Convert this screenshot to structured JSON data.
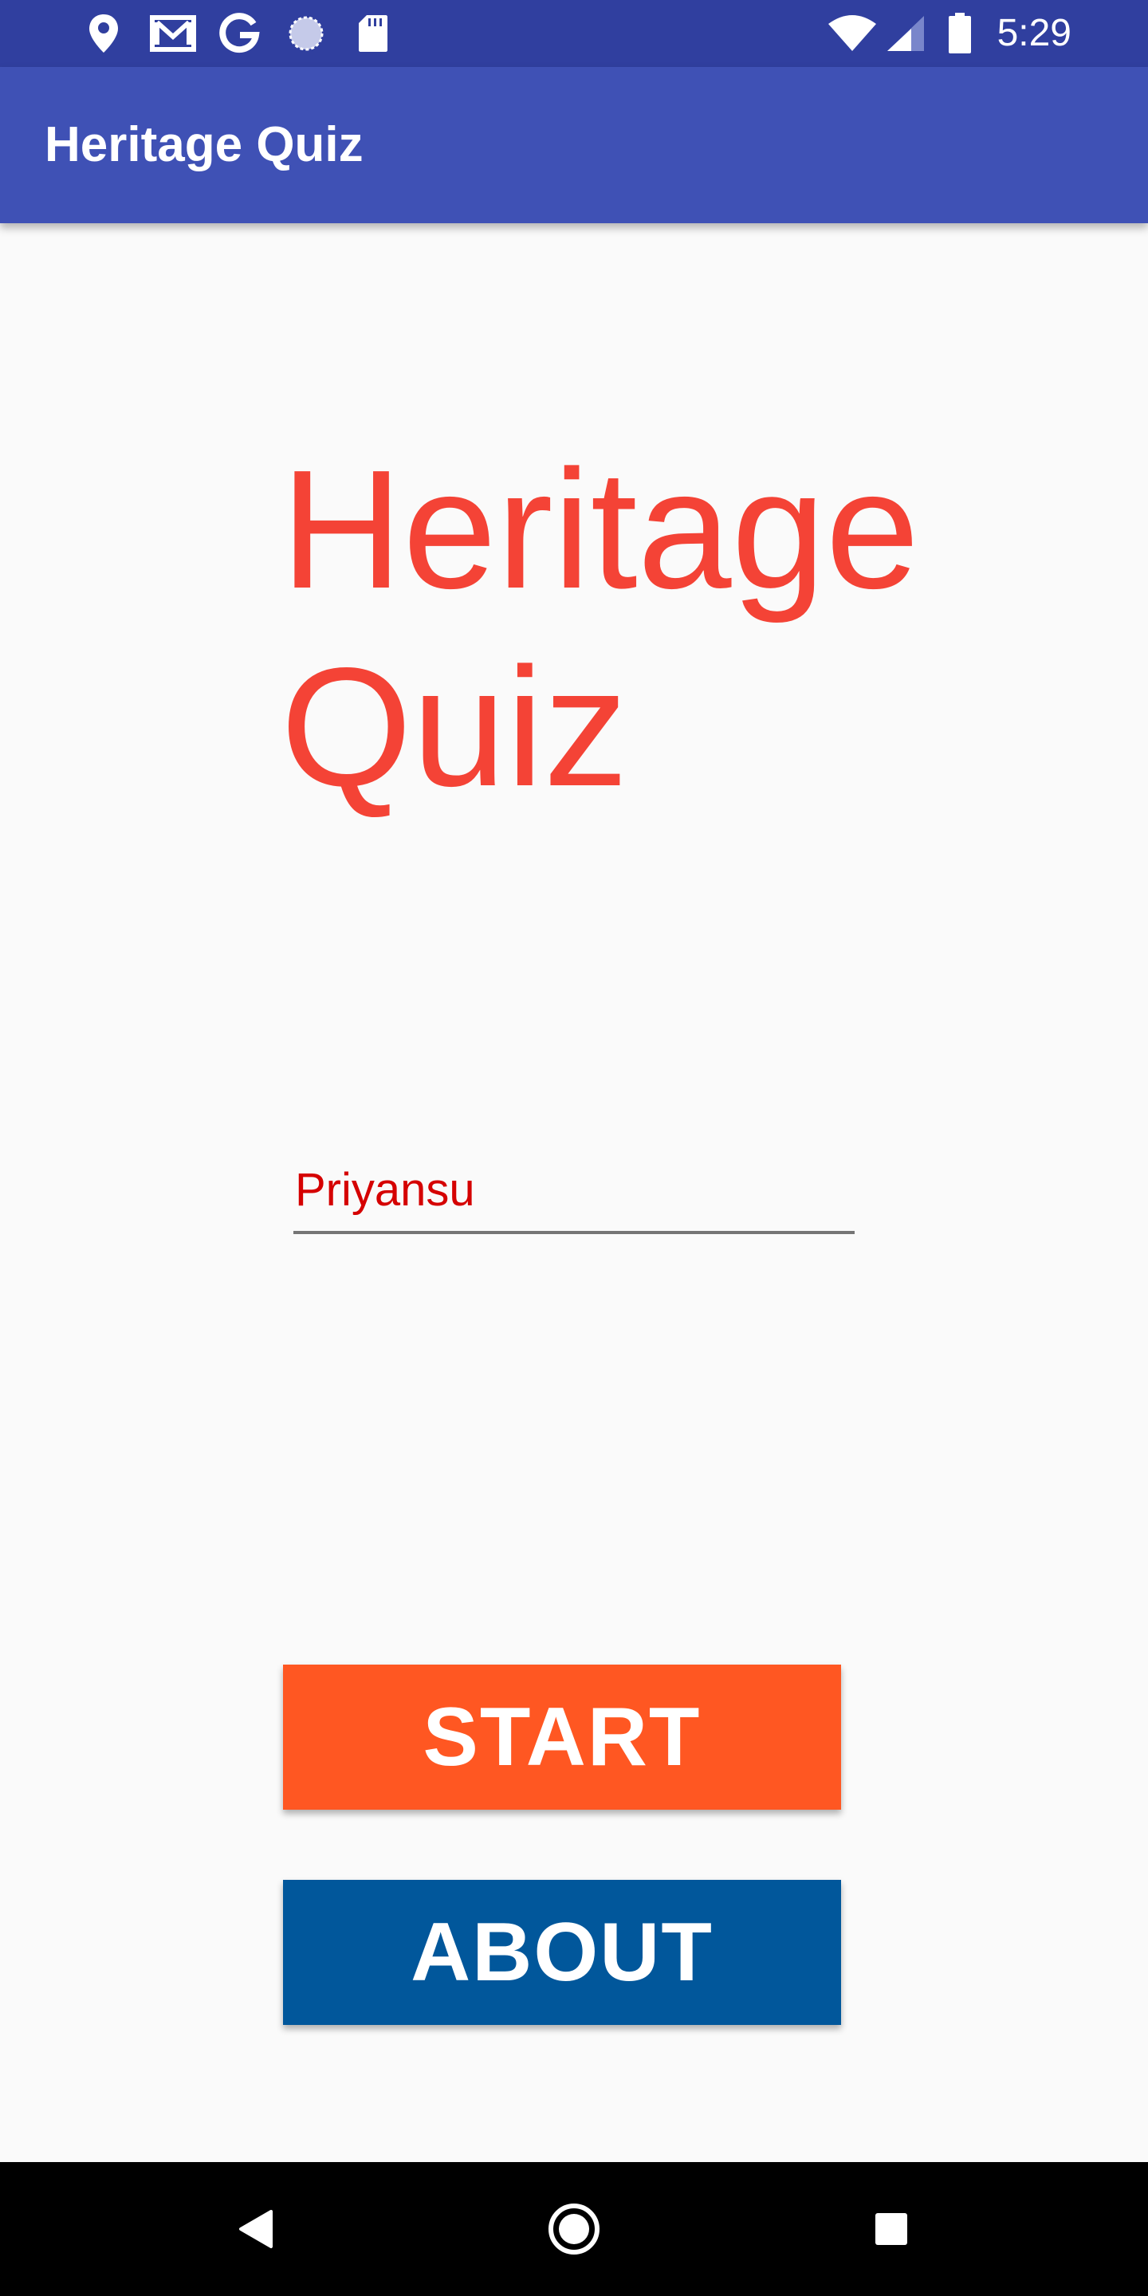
{
  "status_bar": {
    "time": "5:29",
    "left_icons": [
      "location-icon",
      "gmail-icon",
      "google-icon",
      "sync-icon",
      "sd-card-icon"
    ],
    "right_icons": [
      "wifi-icon",
      "signal-icon",
      "battery-icon"
    ],
    "background": "#303f9f"
  },
  "app_bar": {
    "title": "Heritage Quiz",
    "background": "#3f51b5"
  },
  "main": {
    "hero_line1": "Heritage",
    "hero_line2": "Quiz",
    "hero_color": "#f44336",
    "name_input": {
      "value": "Priyansu",
      "color": "#d50000"
    },
    "start_label": "START",
    "start_color": "#ff5722",
    "about_label": "ABOUT",
    "about_color": "#01579b"
  },
  "nav_bar": {
    "icons": [
      "back-icon",
      "home-icon",
      "recents-icon"
    ]
  }
}
